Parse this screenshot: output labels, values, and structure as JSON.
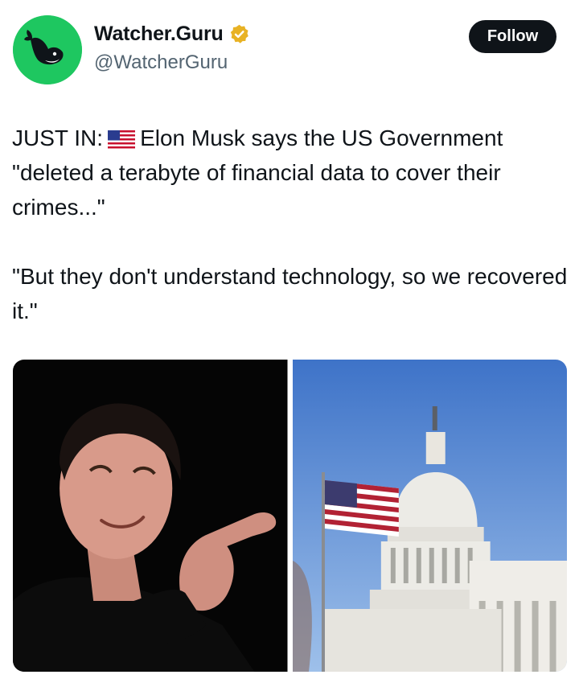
{
  "author": {
    "display_name": "Watcher.Guru",
    "handle": "@WatcherGuru",
    "verified": true,
    "avatar_icon": "whale-logo-icon",
    "avatar_color": "#1ec760",
    "verified_color": "#e8b224"
  },
  "follow_button": {
    "label": "Follow"
  },
  "tweet": {
    "prefix": "JUST IN:",
    "flag_icon": "us-flag-emoji",
    "line1_rest": "Elon Musk says the US Government \"deleted a terabyte of financial data to cover their crimes...\"",
    "paragraph2": "\"But they don't understand technology, so we recovered it.\""
  },
  "media": [
    {
      "name": "elon-musk-photo"
    },
    {
      "name": "us-capitol-photo"
    }
  ]
}
